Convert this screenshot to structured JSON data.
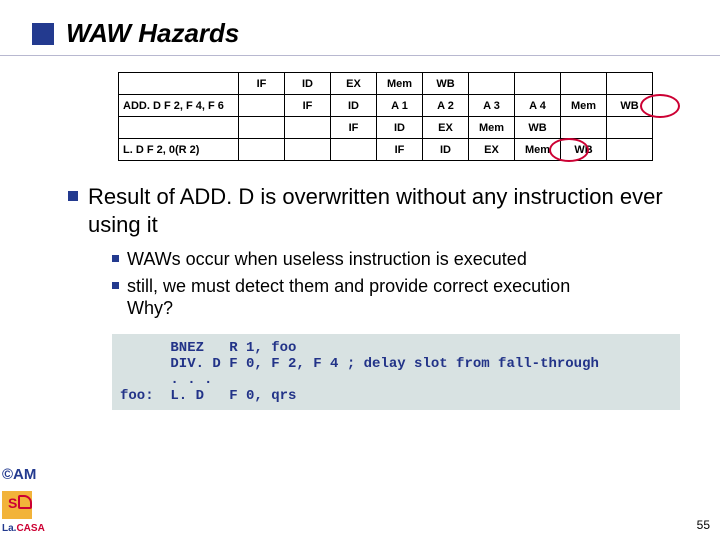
{
  "title": "WAW Hazards",
  "pipeline": {
    "rows": [
      {
        "label": "",
        "cells": [
          "IF",
          "ID",
          "EX",
          "Mem",
          "WB",
          "",
          "",
          "",
          ""
        ]
      },
      {
        "label": "ADD. D F 2, F 4, F 6",
        "cells": [
          "",
          "IF",
          "ID",
          "A 1",
          "A 2",
          "A 3",
          "A 4",
          "Mem",
          "WB"
        ]
      },
      {
        "label": "",
        "cells": [
          "",
          "",
          "IF",
          "ID",
          "EX",
          "Mem",
          "WB",
          "",
          ""
        ]
      },
      {
        "label": "L. D F 2, 0(R 2)",
        "cells": [
          "",
          "",
          "",
          "IF",
          "ID",
          "EX",
          "Mem",
          "WB",
          ""
        ]
      }
    ]
  },
  "bullet_main": "Result of ADD. D is overwritten without any instruction ever using it",
  "sub_bullets": [
    "WAWs occur when useless instruction is executed",
    "still, we must detect them and provide correct execution\nWhy?"
  ],
  "code": "      BNEZ   R 1, foo\n      DIV. D F 0, F 2, F 4 ; delay slot from fall-through\n      . . .\nfoo:  L. D   F 0, qrs",
  "copyright": "©AM",
  "lab": {
    "la": "La.",
    "casa": "CASA"
  },
  "page": "55"
}
